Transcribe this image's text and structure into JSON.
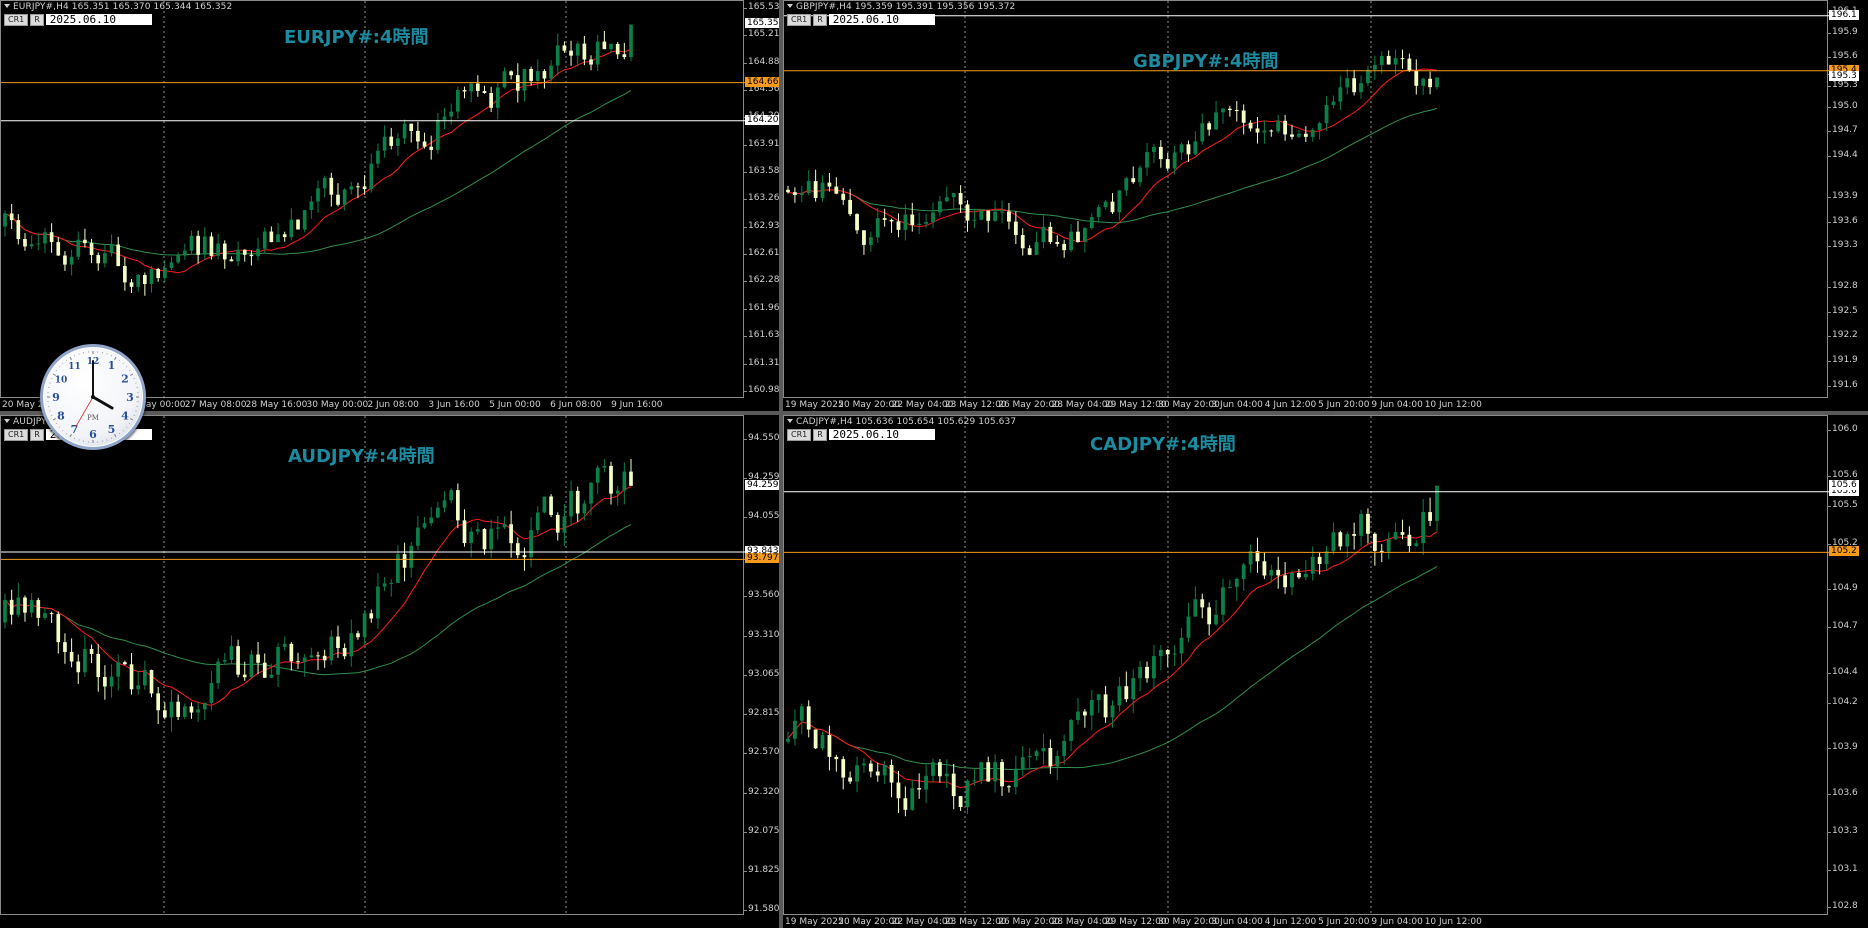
{
  "colors": {
    "bull": "#0b7f48",
    "bear": "#f4ffc6",
    "ma_fast": "#ff1a1a",
    "ma_slow": "#2f8f4f",
    "level_orange": "#f59a1a",
    "level_white": "#ffffff",
    "title": "#1c8a9f",
    "bg": "#000000"
  },
  "panels": [
    {
      "key": "eurjpy",
      "header": "EURJPY#,H4  165.351 165.370 165.344 165.352",
      "cr": "CR1",
      "r": "R",
      "date": "2025.06.10 16:00",
      "title": "EURJPY#:4時間",
      "ylim": [
        160.9,
        165.63
      ],
      "yticks": [
        "165.535",
        "165.210",
        "164.885",
        "164.560",
        "164.207",
        "163.910",
        "163.585",
        "163.260",
        "162.935",
        "162.610",
        "162.285",
        "161.960",
        "161.635",
        "161.310",
        "160.980"
      ],
      "ytick_values": [
        165.535,
        165.21,
        164.885,
        164.56,
        164.235,
        163.91,
        163.585,
        163.26,
        162.935,
        162.61,
        162.285,
        161.96,
        161.635,
        161.31,
        160.98
      ],
      "levels": [
        {
          "value": 164.66,
          "label": "164.660",
          "color": "orange"
        },
        {
          "value": 164.207,
          "label": "164.207",
          "color": "white"
        }
      ],
      "price_label": {
        "value": 165.352,
        "label": "165.352"
      },
      "xticks": [
        "20 May 20",
        "16:00",
        "26 May 00:00",
        "27 May 08:00",
        "28 May 16:00",
        "30 May 00:00",
        "2 Jun 08:00",
        "3 Jun 16:00",
        "5 Jun 00:00",
        "6 Jun 08:00",
        "9 Jun 16:00"
      ],
      "candles_count": 95,
      "start": 162.95,
      "end": 165.35
    },
    {
      "key": "gbpjpy",
      "header": "GBPJPY#,H4  195.359 195.391 195.356 195.372",
      "cr": "CR1",
      "r": "R",
      "date": "2025.06.10 16:00",
      "title": "GBPJPY#:4時間",
      "ylim": [
        191.45,
        196.3
      ],
      "yticks": [
        "196.1",
        "195.9",
        "195.6",
        "195.4",
        "195.3",
        "195.0",
        "194.7",
        "194.4",
        "193.9",
        "193.6",
        "193.3",
        "192.8",
        "192.5",
        "192.2",
        "191.9",
        "191.6"
      ],
      "ytick_values": [
        196.15,
        195.9,
        195.6,
        195.4,
        195.25,
        195.0,
        194.7,
        194.4,
        193.9,
        193.6,
        193.3,
        192.8,
        192.5,
        192.2,
        191.9,
        191.6
      ],
      "levels": [
        {
          "value": 196.12,
          "label": "196.1",
          "color": "white"
        },
        {
          "value": 195.45,
          "label": "195.4",
          "color": "orange"
        }
      ],
      "price_label": {
        "value": 195.37,
        "label": "195.3"
      },
      "xticks": [
        "19 May 2025",
        "20 May 20:00",
        "22 May 04:00",
        "23 May 12:00",
        "26 May 20:00",
        "28 May 04:00",
        "29 May 12:00",
        "30 May 20:00",
        "3 Jun 04:00",
        "4 Jun 12:00",
        "5 Jun 20:00",
        "9 Jun 04:00",
        "10 Jun 12:00"
      ],
      "candles_count": 95,
      "start": 194.0,
      "end": 195.37
    },
    {
      "key": "audjpy",
      "header": "AUDJPY#,H4  94.244 94.259",
      "cr": "CR1",
      "r": "R",
      "date": "2025.06.10 16:00",
      "title": "AUDJPY#:4時間",
      "ylim": [
        91.55,
        94.7
      ],
      "yticks": [
        "94.550",
        "94.259",
        "94.055",
        "93.843",
        "93.560",
        "93.310",
        "93.065",
        "92.815",
        "92.570",
        "92.320",
        "92.075",
        "91.825",
        "91.580"
      ],
      "ytick_values": [
        94.55,
        94.3,
        94.055,
        93.843,
        93.56,
        93.31,
        93.065,
        92.815,
        92.57,
        92.32,
        92.075,
        91.825,
        91.58
      ],
      "levels": [
        {
          "value": 93.843,
          "label": "93.843",
          "color": "white"
        },
        {
          "value": 93.797,
          "label": "93.797",
          "color": "orange"
        }
      ],
      "price_label": {
        "value": 94.259,
        "label": "94.259"
      },
      "xticks": [],
      "candles_count": 95,
      "start": 93.4,
      "end": 94.26
    },
    {
      "key": "cadjpy",
      "header": "CADJPY#,H4  105.636 105.654 105.629 105.637",
      "cr": "CR1",
      "r": "R",
      "date": "2025.06.10 16:00",
      "title": "CADJPY#:4時間",
      "ylim": [
        102.8,
        106.1
      ],
      "yticks": [
        "106.0",
        "105.6",
        "105.5",
        "105.2",
        "104.9",
        "104.7",
        "104.4",
        "104.2",
        "103.9",
        "103.6",
        "103.3",
        "103.1",
        "102.8"
      ],
      "ytick_values": [
        106.0,
        105.7,
        105.5,
        105.25,
        104.95,
        104.7,
        104.4,
        104.2,
        103.9,
        103.6,
        103.35,
        103.1,
        102.85
      ],
      "levels": [
        {
          "value": 105.6,
          "label": "105.6",
          "color": "white"
        },
        {
          "value": 105.2,
          "label": "105.2",
          "color": "orange"
        }
      ],
      "price_label": {
        "value": 105.637,
        "label": "105.6"
      },
      "xticks": [
        "19 May 2025",
        "20 May 20:00",
        "22 May 04:00",
        "23 May 12:00",
        "26 May 20:00",
        "28 May 04:00",
        "29 May 12:00",
        "30 May 20:00",
        "3 Jun 04:00",
        "4 Jun 12:00",
        "5 Jun 20:00",
        "9 Jun 04:00",
        "10 Jun 12:00"
      ],
      "candles_count": 95,
      "start": 103.95,
      "end": 105.64
    }
  ],
  "clock": {
    "period": "PM",
    "numbers": [
      "12",
      "1",
      "2",
      "3",
      "4",
      "5",
      "6",
      "7",
      "8",
      "9",
      "10",
      "11"
    ],
    "hour": 16,
    "minute": 0
  }
}
